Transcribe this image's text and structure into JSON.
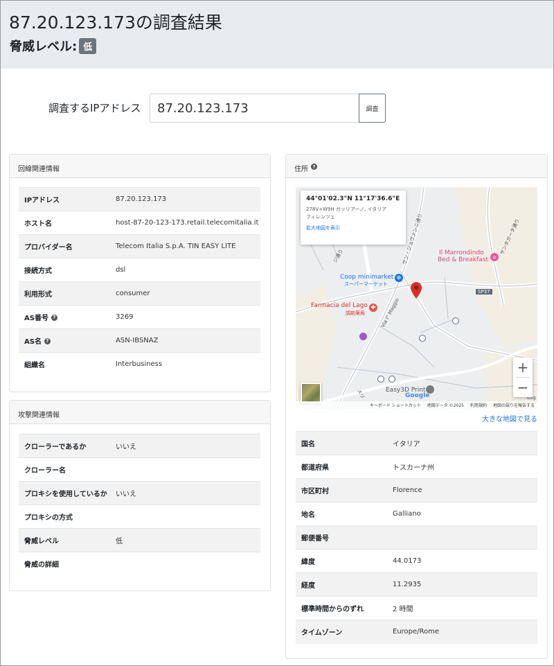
{
  "header": {
    "title": "87.20.123.173の調査結果",
    "threat_label": "脅威レベル:",
    "threat_value": "低"
  },
  "search": {
    "label": "調査するIPアドレス",
    "value": "87.20.123.173",
    "button": "調査"
  },
  "network_card": {
    "title": "回線関連情報",
    "rows": [
      {
        "key": "IPアドレス",
        "value": "87.20.123.173"
      },
      {
        "key": "ホスト名",
        "value": "host-87-20-123-173.retail.telecomitalia.it"
      },
      {
        "key": "プロバイダー名",
        "value": "Telecom Italia S.p.A. TIN EASY LITE"
      },
      {
        "key": "接続方式",
        "value": "dsl"
      },
      {
        "key": "利用形式",
        "value": "consumer"
      },
      {
        "key": "AS番号",
        "value": "3269"
      },
      {
        "key": "AS名",
        "value": "ASN-IBSNAZ"
      },
      {
        "key": "組織名",
        "value": "Interbusiness"
      }
    ]
  },
  "attack_card": {
    "title": "攻撃関連情報",
    "rows": [
      {
        "key": "クローラーであるか",
        "value": "いいえ"
      },
      {
        "key": "クローラー名",
        "value": ""
      },
      {
        "key": "プロキシを使用しているか",
        "value": "いいえ"
      },
      {
        "key": "プロキシの方式",
        "value": ""
      },
      {
        "key": "脅威レベル",
        "value": "低"
      },
      {
        "key": "脅威の詳細",
        "value": ""
      }
    ]
  },
  "address_card": {
    "title": "住所",
    "rows": [
      {
        "key": "国名",
        "value": "イタリア"
      },
      {
        "key": "都道府県",
        "value": "トスカーナ州"
      },
      {
        "key": "市区町村",
        "value": "Florence"
      },
      {
        "key": "地名",
        "value": "Galliano"
      },
      {
        "key": "郵便番号",
        "value": ""
      },
      {
        "key": "緯度",
        "value": "44.0173"
      },
      {
        "key": "経度",
        "value": "11.2935"
      },
      {
        "key": "標準時間からのずれ",
        "value": "2 時間"
      },
      {
        "key": "タイムゾーン",
        "value": "Europe/Rome"
      }
    ]
  },
  "map": {
    "info_coords": "44°01'02.3\"N 11°17'36.6\"E",
    "info_address_1": "278V+W9H ガッリアーノ, イタリア",
    "info_address_2": "フィレンツェ",
    "info_link": "拡大地図を表示",
    "larger_map": "大きな地図で見る",
    "zoom_in": "+",
    "zoom_out": "−",
    "footer": [
      "キーボード ショートカット",
      "地図データ ©2025",
      "利用規約",
      "地図の誤りを報告する"
    ],
    "labels": {
      "coop": "Coop minimarket",
      "coop_sub": "スーパーマーケット",
      "farmacia": "Farmacia del Lago",
      "farmacia_sub": "調剤薬局",
      "marrondindo_1": "Il Marrondindo",
      "marrondindo_2": "Bed & Breakfast",
      "easy3d": "Easy3D Print",
      "via_maggio": "Via I° Maggio",
      "sp37": "SP37",
      "google": "Google",
      "lag": "Lag",
      "road_sanjohn": "サン・ジョヴァンニ通り",
      "road_santa": "サンタガータ通り",
      "road_left": "ジ通り",
      "road_mer": "メリ"
    }
  },
  "colors": {
    "header_bg": "#e9ecef",
    "badge_bg": "#6c757d",
    "link": "#1a73e8",
    "pin": "#d93025"
  }
}
